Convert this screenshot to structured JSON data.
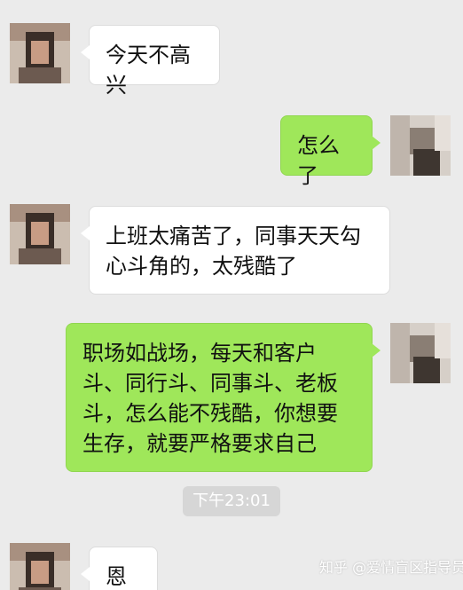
{
  "messages": [
    {
      "side": "left",
      "sender": "friend",
      "text": "今天不高兴"
    },
    {
      "side": "right",
      "sender": "me",
      "text": "怎么了"
    },
    {
      "side": "left",
      "sender": "friend",
      "text": "上班太痛苦了，同事天天勾心斗角的，太残酷了"
    },
    {
      "side": "right",
      "sender": "me",
      "text": "职场如战场，每天和客户斗、同行斗、同事斗、老板斗，怎么能不残酷，你想要生存，就要严格要求自己"
    },
    {
      "side": "left",
      "sender": "friend",
      "text": "恩"
    }
  ],
  "timestamp": "下午23:01",
  "watermark": "知乎 @爱情盲区指导员",
  "colors": {
    "background": "#ebebeb",
    "sent_bubble": "#9fe75a",
    "received_bubble": "#ffffff"
  }
}
